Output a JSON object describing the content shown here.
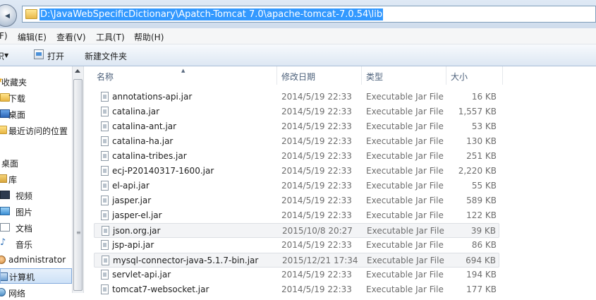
{
  "address": {
    "path": "D:\\JavaWebSpecificDictionary\\Apatch-Tomcat 7.0\\apache-tomcat-7.0.54\\lib"
  },
  "menu": [
    "F)",
    "编辑(E)",
    "查看(V)",
    "工具(T)",
    "帮助(H)"
  ],
  "toolbar": {
    "organize_partial": "织",
    "open_label": "打开",
    "new_folder_label": "新建文件夹"
  },
  "nav": {
    "items": [
      {
        "label": "收藏夹",
        "icon": "star-icon"
      },
      {
        "label": "下载",
        "icon": "folder-icon"
      },
      {
        "label": "桌面",
        "icon": "desktop-icon"
      },
      {
        "label": "最近访问的位置",
        "icon": "recent-places-icon"
      },
      {
        "label": "桌面",
        "icon": "desktop-icon"
      },
      {
        "label": "库",
        "icon": "library-icon"
      },
      {
        "label": "视频",
        "icon": "video-icon"
      },
      {
        "label": "图片",
        "icon": "pictures-icon"
      },
      {
        "label": "文档",
        "icon": "documents-icon"
      },
      {
        "label": "音乐",
        "icon": "music-icon"
      },
      {
        "label": "administrator",
        "icon": "user-icon"
      },
      {
        "label": "计算机",
        "icon": "computer-icon"
      },
      {
        "label": "网络",
        "icon": "network-icon"
      }
    ]
  },
  "columns": {
    "name": "名称",
    "date": "修改日期",
    "type": "类型",
    "size": "大小"
  },
  "files": [
    {
      "name": "annotations-api.jar",
      "date": "2014/5/19 22:33",
      "type": "Executable Jar File",
      "size": "16 KB"
    },
    {
      "name": "catalina.jar",
      "date": "2014/5/19 22:33",
      "type": "Executable Jar File",
      "size": "1,557 KB"
    },
    {
      "name": "catalina-ant.jar",
      "date": "2014/5/19 22:33",
      "type": "Executable Jar File",
      "size": "53 KB"
    },
    {
      "name": "catalina-ha.jar",
      "date": "2014/5/19 22:33",
      "type": "Executable Jar File",
      "size": "130 KB"
    },
    {
      "name": "catalina-tribes.jar",
      "date": "2014/5/19 22:33",
      "type": "Executable Jar File",
      "size": "251 KB"
    },
    {
      "name": "ecj-P20140317-1600.jar",
      "date": "2014/5/19 22:33",
      "type": "Executable Jar File",
      "size": "2,220 KB"
    },
    {
      "name": "el-api.jar",
      "date": "2014/5/19 22:33",
      "type": "Executable Jar File",
      "size": "55 KB"
    },
    {
      "name": "jasper.jar",
      "date": "2014/5/19 22:33",
      "type": "Executable Jar File",
      "size": "589 KB"
    },
    {
      "name": "jasper-el.jar",
      "date": "2014/5/19 22:33",
      "type": "Executable Jar File",
      "size": "122 KB"
    },
    {
      "name": "json.org.jar",
      "date": "2015/10/8 20:27",
      "type": "Executable Jar File",
      "size": "39 KB"
    },
    {
      "name": "jsp-api.jar",
      "date": "2014/5/19 22:33",
      "type": "Executable Jar File",
      "size": "86 KB"
    },
    {
      "name": "mysql-connector-java-5.1.7-bin.jar",
      "date": "2015/12/21 17:34",
      "type": "Executable Jar File",
      "size": "694 KB"
    },
    {
      "name": "servlet-api.jar",
      "date": "2014/5/19 22:33",
      "type": "Executable Jar File",
      "size": "194 KB"
    },
    {
      "name": "tomcat7-websocket.jar",
      "date": "2014/5/19 22:33",
      "type": "Executable Jar File",
      "size": "177 KB"
    }
  ]
}
